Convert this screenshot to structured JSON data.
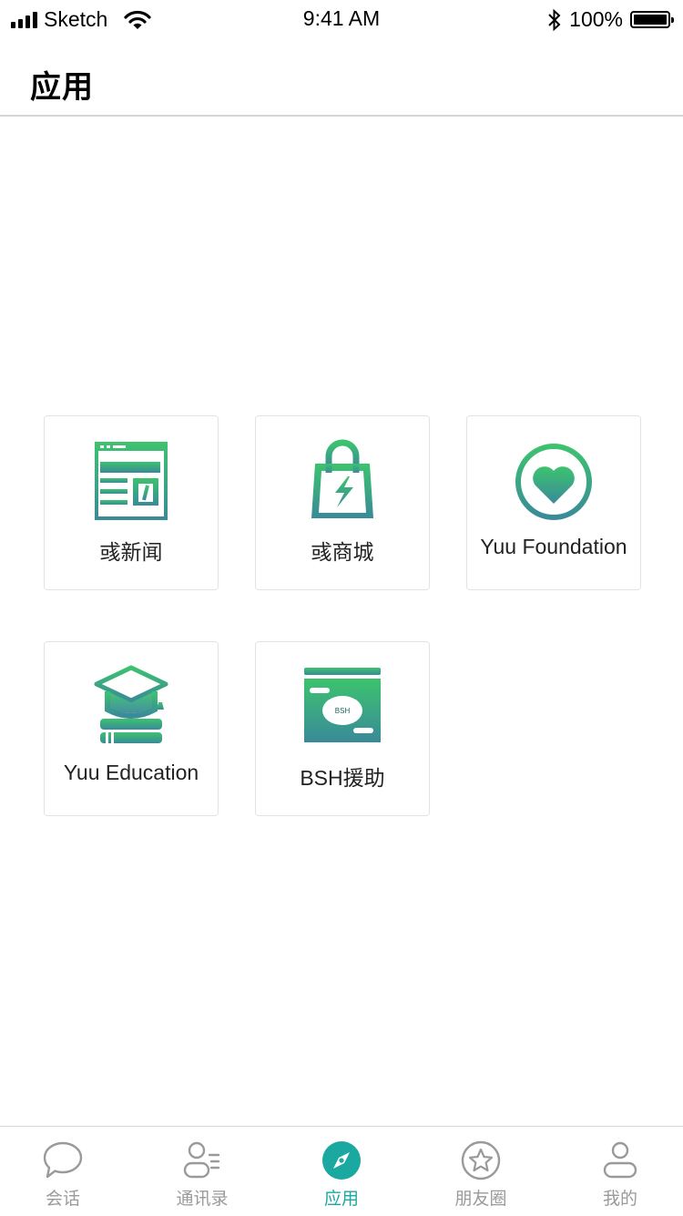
{
  "status_bar": {
    "carrier": "Sketch",
    "time": "9:41 AM",
    "battery": "100%"
  },
  "header": {
    "title": "应用"
  },
  "apps": [
    {
      "label": "彧新闻",
      "icon": "newspaper-icon"
    },
    {
      "label": "彧商城",
      "icon": "shopping-bag-icon"
    },
    {
      "label": "Yuu Foundation",
      "icon": "heart-icon"
    },
    {
      "label": "Yuu Education",
      "icon": "graduation-cap-icon"
    },
    {
      "label": "BSH援助",
      "icon": "bsh-card-icon",
      "badge_text": "BSH"
    }
  ],
  "tabs": [
    {
      "label": "会话",
      "icon": "chat-bubble-icon",
      "active": false
    },
    {
      "label": "通讯录",
      "icon": "contacts-icon",
      "active": false
    },
    {
      "label": "应用",
      "icon": "compass-icon",
      "active": true
    },
    {
      "label": "朋友圈",
      "icon": "star-icon",
      "active": false
    },
    {
      "label": "我的",
      "icon": "profile-icon",
      "active": false
    }
  ],
  "colors": {
    "accent": "#1aa8a0",
    "icon_gradient_top": "#3cc36e",
    "icon_gradient_bottom": "#3a8a99",
    "inactive_tab": "#9a9a9a"
  }
}
